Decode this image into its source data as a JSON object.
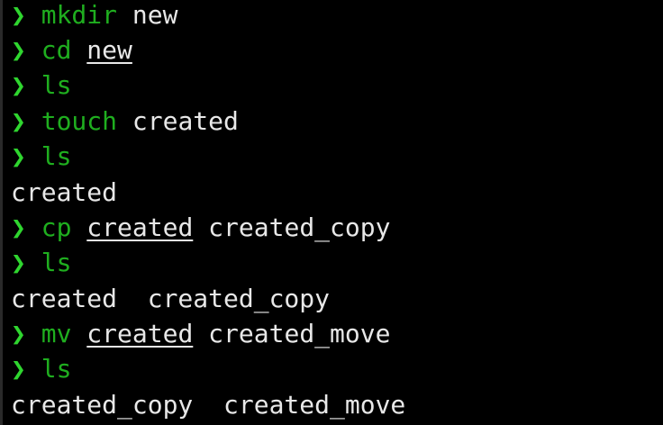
{
  "terminal": {
    "prompt_symbol": "❯",
    "lines": [
      {
        "type": "command",
        "cmd": "mkdir",
        "args": [
          {
            "text": "new",
            "underline": false
          }
        ]
      },
      {
        "type": "command",
        "cmd": "cd",
        "args": [
          {
            "text": "new",
            "underline": true
          }
        ]
      },
      {
        "type": "command",
        "cmd": "ls",
        "args": []
      },
      {
        "type": "command",
        "cmd": "touch",
        "args": [
          {
            "text": "created",
            "underline": false
          }
        ]
      },
      {
        "type": "command",
        "cmd": "ls",
        "args": []
      },
      {
        "type": "output",
        "text": "created"
      },
      {
        "type": "command",
        "cmd": "cp",
        "args": [
          {
            "text": "created",
            "underline": true
          },
          {
            "text": "created_copy",
            "underline": false
          }
        ]
      },
      {
        "type": "command",
        "cmd": "ls",
        "args": []
      },
      {
        "type": "output",
        "text": "created  created_copy"
      },
      {
        "type": "command",
        "cmd": "mv",
        "args": [
          {
            "text": "created",
            "underline": true
          },
          {
            "text": "created_move",
            "underline": false
          }
        ]
      },
      {
        "type": "command",
        "cmd": "ls",
        "args": []
      },
      {
        "type": "output",
        "text": "created_copy  created_move"
      }
    ]
  },
  "colors": {
    "background": "#000000",
    "prompt": "#2fd62f",
    "command": "#1fae1f",
    "text": "#e8e8e8"
  }
}
